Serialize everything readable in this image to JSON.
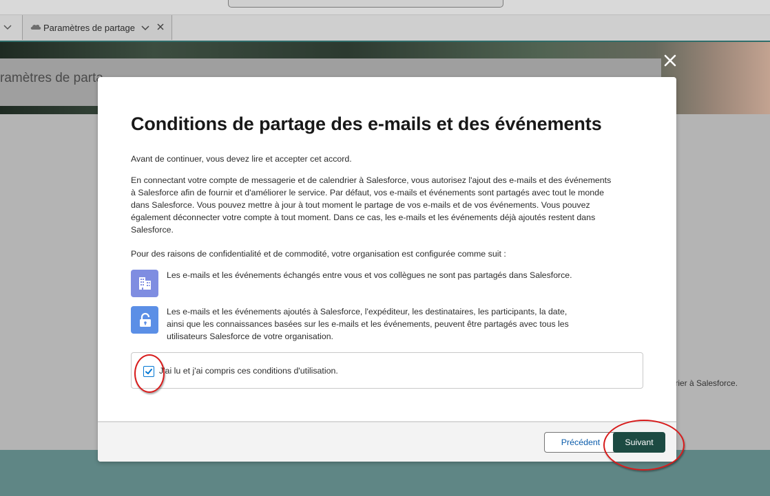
{
  "tabbar": {
    "tab_label": "Paramètres de partage"
  },
  "background": {
    "banner_title": "ramètres de parta",
    "right_text": "ndrier à Salesforce."
  },
  "modal": {
    "title": "Conditions de partage des e-mails et des événements",
    "intro": "Avant de continuer, vous devez lire et accepter cet accord.",
    "main_paragraph": "En connectant votre compte de messagerie et de calendrier à Salesforce, vous autorisez l'ajout des e-mails et des événements à Salesforce afin de fournir et d'améliorer le service. Par défaut, vos e-mails et événements sont partagés avec tout le monde dans Salesforce. Vous pouvez mettre à jour à tout moment le partage de vos e-mails et de vos événements. Vous pouvez également déconnecter votre compte à tout moment. Dans ce cas, les e-mails et les événements déjà ajoutés restent dans Salesforce.",
    "config_intro": "Pour des raisons de confidentialité et de commodité, votre organisation est configurée comme suit :",
    "items": [
      {
        "icon": "building-icon",
        "text": "Les e-mails et les événements échangés entre vous et vos collègues ne sont pas partagés dans Salesforce."
      },
      {
        "icon": "unlock-icon",
        "text": "Les e-mails et les événements ajoutés à Salesforce, l'expéditeur, les destinataires, les participants, la date, ainsi que les connaissances basées sur les e-mails et les événements, peuvent être partagés avec tous les utilisateurs Salesforce de votre organisation."
      }
    ],
    "agree_label": "J'ai lu et j'ai compris ces conditions d'utilisation.",
    "agree_checked": true,
    "prev_label": "Précédent",
    "next_label": "Suivant"
  },
  "colors": {
    "primary_button": "#1c4a42",
    "checkbox_accent": "#0176d3",
    "annotation": "#d81b1b",
    "building_icon_bg": "#7f8de1",
    "lock_icon_bg": "#5b8fe6"
  }
}
